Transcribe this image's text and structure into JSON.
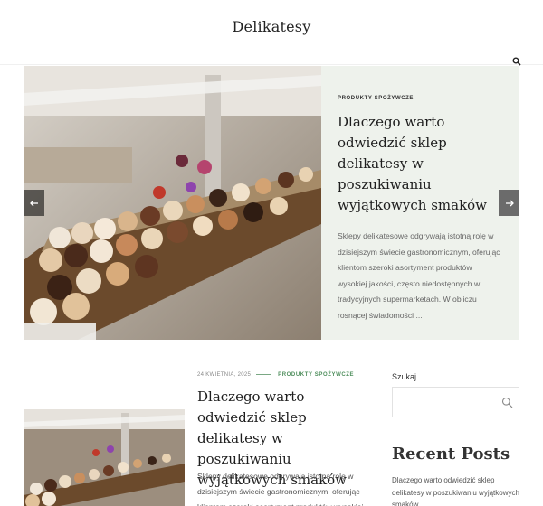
{
  "site": {
    "title": "Delikatesy"
  },
  "header": {
    "search_icon": "search-icon"
  },
  "slider": {
    "category": "PRODUKTY SPOŻYWCZE",
    "title": "Dlaczego warto odwiedzić sklep delikatesy w poszukiwaniu wyjątkowych smaków",
    "excerpt": "Sklepy delikatesowe odgrywają istotną rolę w dzisiejszym świecie gastronomicznym, oferując klientom szeroki asortyment produktów wysokiej jakości, często niedostępnych w tradycyjnych supermarketach. W obliczu rosnącej świadomości ...",
    "prev_icon": "arrow-left-icon",
    "next_icon": "arrow-right-icon"
  },
  "post": {
    "date": "24 KWIETNIA, 2025",
    "category": "PRODUKTY SPOŻYWCZE",
    "title": "Dlaczego warto odwiedzić sklep delikatesy w poszukiwaniu wyjątkowych smaków",
    "excerpt": "Sklepy delikatesowe odgrywają istotną rolę w dzisiejszym świecie gastronomicznym, oferując klientom szeroki asortyment produktów wysokiej"
  },
  "sidebar": {
    "search_label": "Szukaj",
    "search_value": "",
    "search_placeholder": "",
    "recent_title": "Recent Posts",
    "recent_posts": [
      "Dlaczego warto odwiedzić sklep delikatesy w poszukiwaniu wyjątkowych smaków"
    ]
  },
  "colors": {
    "panel_bg": "#eef2ec",
    "accent": "#4f8f5d"
  }
}
